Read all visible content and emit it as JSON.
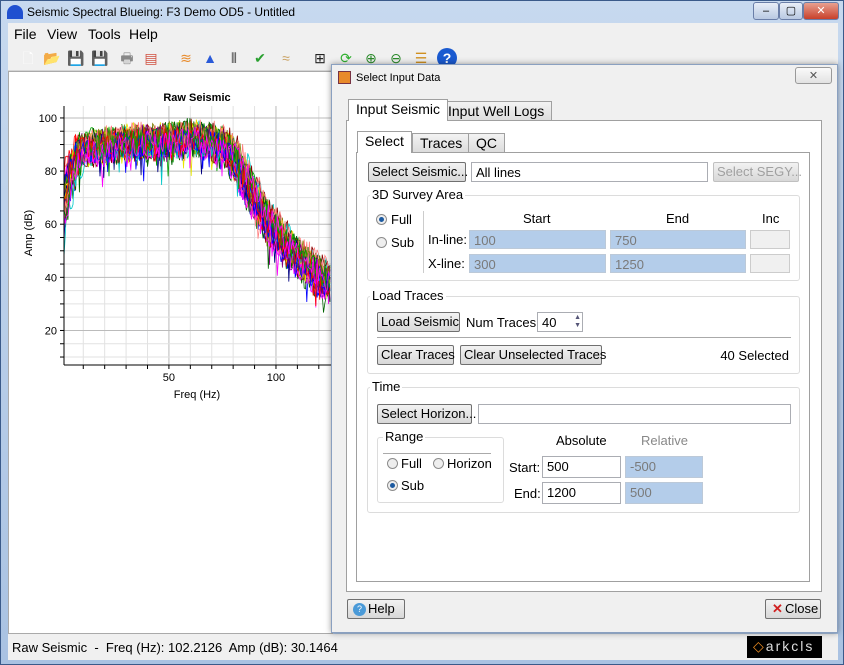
{
  "window": {
    "title": "Seismic Spectral Blueing: F3 Demo OD5 - Untitled",
    "controls": [
      "–",
      "▢",
      "✕"
    ]
  },
  "menu": [
    "File",
    "View",
    "Tools",
    "Help"
  ],
  "toolbar": [
    {
      "icon": "new-file-icon",
      "glyph": "🗋",
      "color": "#ffffff"
    },
    {
      "icon": "open-folder-icon",
      "glyph": "📂",
      "color": "#f3c85a"
    },
    {
      "icon": "save-icon",
      "glyph": "💾",
      "color": "#333333"
    },
    {
      "icon": "save-as-icon",
      "glyph": "💾",
      "color": "#999999"
    },
    {
      "icon": "print-icon",
      "glyph": "🖶",
      "color": "#888888"
    },
    {
      "icon": "report-icon",
      "glyph": "▤",
      "color": "#d05040"
    },
    {
      "icon": "seismic-well-icon",
      "glyph": "≋",
      "color": "#e88a2a"
    },
    {
      "icon": "spectrum-icon",
      "glyph": "▲",
      "color": "#2a5ad8"
    },
    {
      "icon": "traces-icon",
      "glyph": "⦀",
      "color": "#444444"
    },
    {
      "icon": "check-icon",
      "glyph": "✔",
      "color": "#2aa030"
    },
    {
      "icon": "operator-icon",
      "glyph": "≈",
      "color": "#c8a060"
    },
    {
      "icon": "grid-layout-icon",
      "glyph": "⊞",
      "color": "#222222"
    },
    {
      "icon": "refresh-icon",
      "glyph": "⟳",
      "color": "#30b030"
    },
    {
      "icon": "zoom-in-icon",
      "glyph": "⊕",
      "color": "#2a8a2a"
    },
    {
      "icon": "zoom-out-icon",
      "glyph": "⊖",
      "color": "#2a8a2a"
    },
    {
      "icon": "layers-icon",
      "glyph": "☰",
      "color": "#d09020"
    },
    {
      "icon": "help-icon",
      "glyph": "?",
      "color": "#1a5ad0"
    }
  ],
  "chart_data": {
    "type": "line",
    "title": "Raw Seismic",
    "xlabel": "Freq (Hz)",
    "ylabel": "Amp (dB)",
    "xlim": [
      1,
      125.7
    ],
    "ylim": [
      7,
      104.5
    ],
    "xticks": [
      50,
      100
    ],
    "yticks": [
      20,
      40,
      60,
      80,
      100
    ],
    "grid": true,
    "num_series": 40,
    "envelope": {
      "x": [
        1,
        4,
        8,
        15,
        25,
        35,
        45,
        55,
        60,
        65,
        75,
        80,
        85,
        90,
        95,
        100,
        105,
        110,
        115,
        120,
        125
      ],
      "y": [
        70,
        80,
        88,
        89,
        90,
        91,
        91,
        92,
        93,
        92,
        90,
        86,
        78,
        70,
        63,
        57,
        52,
        48,
        44,
        41,
        38
      ]
    }
  },
  "status": {
    "text": "Raw Seismic  -  Freq (Hz): 102.2126  Amp (dB): 30.1464",
    "logo": "arkcls"
  },
  "dialog": {
    "title": "Select Input Data",
    "close_glyph": "✕",
    "tabs": [
      "Input Seismic",
      "Input Well Logs"
    ],
    "subtabs": [
      "Select",
      "Traces",
      "QC"
    ],
    "select_seismic": "Select Seismic...",
    "seismic_value": "All lines",
    "select_segy": "Select SEGY...",
    "survey": {
      "title": "3D Survey Area",
      "full": "Full",
      "sub": "Sub",
      "mode": "Full",
      "headers": [
        "Start",
        "End",
        "Inc"
      ],
      "inline_label": "In-line:",
      "inline": [
        "100",
        "750",
        ""
      ],
      "xline_label": "X-line:",
      "xline": [
        "300",
        "1250",
        ""
      ]
    },
    "load": {
      "title": "Load Traces",
      "load_button": "Load Seismic",
      "num_label": "Num Traces:",
      "num": "40",
      "clear": "Clear Traces",
      "clear_unselected": "Clear Unselected Traces",
      "selected": "40 Selected"
    },
    "time": {
      "title": "Time",
      "select_horizon": "Select Horizon...",
      "horizon_value": "",
      "range_title": "Range",
      "full": "Full",
      "horizon": "Horizon",
      "sub": "Sub",
      "mode": "Sub",
      "absolute": "Absolute",
      "relative": "Relative",
      "start_label": "Start:",
      "end_label": "End:",
      "abs_start": "500",
      "abs_end": "1200",
      "rel_start": "-500",
      "rel_end": "500"
    },
    "help": "Help",
    "close": "Close"
  }
}
